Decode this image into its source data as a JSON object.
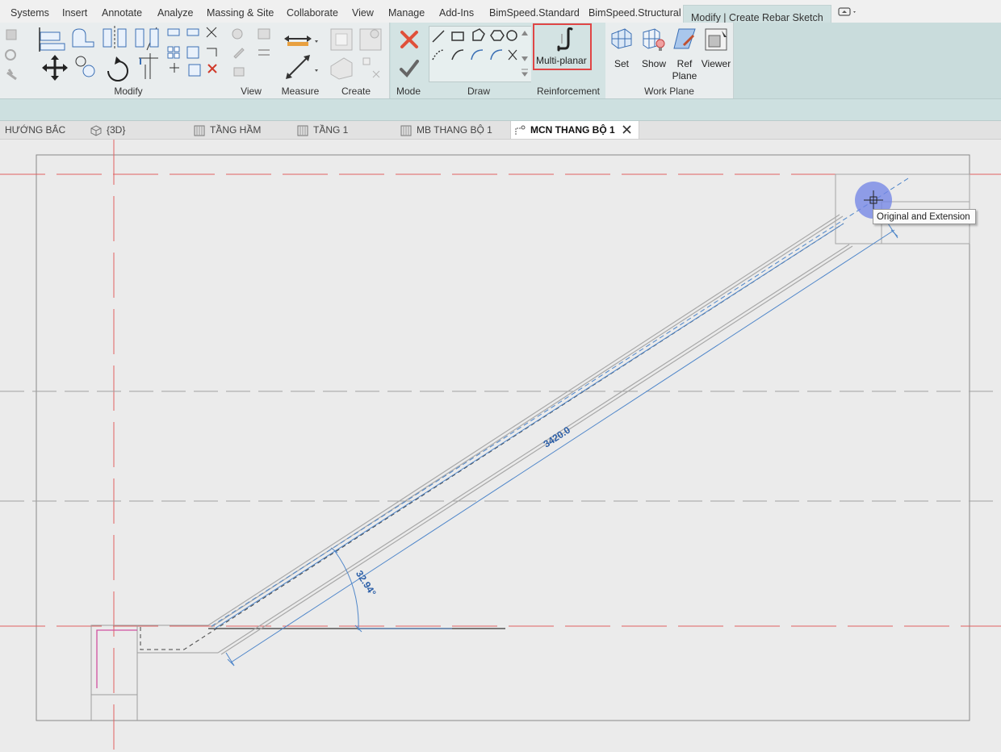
{
  "ribbon_tabs": [
    {
      "label": "Systems"
    },
    {
      "label": "Insert"
    },
    {
      "label": "Annotate"
    },
    {
      "label": "Analyze"
    },
    {
      "label": "Massing & Site"
    },
    {
      "label": "Collaborate"
    },
    {
      "label": "View"
    },
    {
      "label": "Manage"
    },
    {
      "label": "Add-Ins"
    },
    {
      "label": "BimSpeed.Standard"
    },
    {
      "label": "BimSpeed.Structural"
    },
    {
      "label": "Modify | Create Rebar Sketch"
    }
  ],
  "ribbon_panels": {
    "modify": "Modify",
    "view": "View",
    "measure": "Measure",
    "create": "Create",
    "mode": "Mode",
    "draw": "Draw",
    "reinforcement": "Reinforcement",
    "work_plane": "Work Plane"
  },
  "buttons": {
    "multi_planar": "Multi-planar",
    "set": "Set",
    "show": "Show",
    "ref_plane": "Ref Plane",
    "viewer": "Viewer"
  },
  "view_tabs": [
    {
      "label": "HƯỚNG BẮC",
      "icon": "elevation-view-icon"
    },
    {
      "label": "{3D}",
      "icon": "3d-view-icon"
    },
    {
      "label": "TẦNG HẦM",
      "icon": "floor-plan-icon"
    },
    {
      "label": "TẦNG 1",
      "icon": "floor-plan-icon"
    },
    {
      "label": "MB THANG BỘ 1",
      "icon": "floor-plan-icon"
    },
    {
      "label": "MCN THANG BỘ 1",
      "icon": "section-view-icon",
      "active": true
    }
  ],
  "canvas": {
    "dimension_length": "3420.0",
    "dimension_angle": "32.94°",
    "tooltip": "Original and Extension"
  },
  "colors": {
    "ribbon_bg": "#c9dcdc",
    "highlight_box": "#e04545",
    "sketch_blue": "#4f86c9",
    "ref_plane_red": "#e06060",
    "cursor_circle": "#6f82e6"
  }
}
